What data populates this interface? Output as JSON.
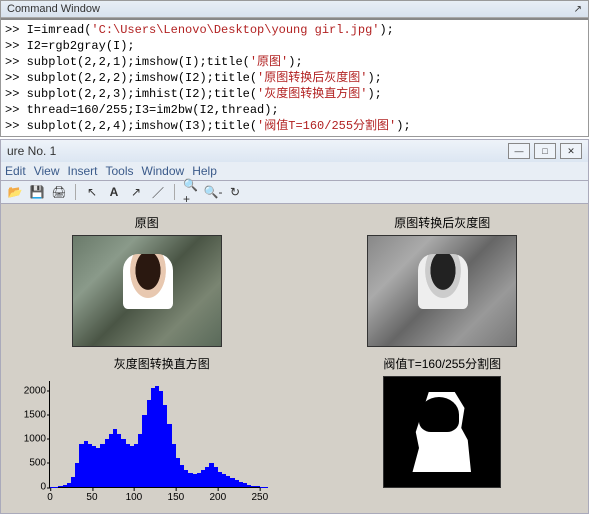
{
  "command_window": {
    "title": "Command Window",
    "lines": [
      {
        "prompt": ">> ",
        "code": "I=imread(",
        "str": "'C:\\Users\\Lenovo\\Desktop\\young girl.jpg'",
        "code2": ");"
      },
      {
        "prompt": ">> ",
        "code": "I2=rgb2gray(I);"
      },
      {
        "prompt": ">> ",
        "code": "subplot(2,2,1);imshow(I);title(",
        "str": "'原图'",
        "code2": ");"
      },
      {
        "prompt": ">> ",
        "code": "subplot(2,2,2);imshow(I2);title(",
        "str": "'原图转换后灰度图'",
        "code2": ");"
      },
      {
        "prompt": ">> ",
        "code": "subplot(2,2,3);imhist(I2);title(",
        "str": "'灰度图转换直方图'",
        "code2": ");"
      },
      {
        "prompt": ">> ",
        "code": "thread=160/255;I3=im2bw(I2,thread);"
      },
      {
        "prompt": ">> ",
        "code": "subplot(2,2,4);imshow(I3);title(",
        "str": "'阀值T=160/255分割图'",
        "code2": ");"
      }
    ]
  },
  "figure_window": {
    "title": "ure No. 1",
    "menu": [
      "Edit",
      "View",
      "Insert",
      "Tools",
      "Window",
      "Help"
    ]
  },
  "subplots": {
    "t1": "原图",
    "t2": "原图转换后灰度图",
    "t3": "灰度图转换直方图",
    "t4": "阀值T=160/255分割图"
  },
  "chart_data": {
    "type": "bar",
    "title": "灰度图转换直方图",
    "xlabel": "",
    "ylabel": "",
    "xlim": [
      0,
      255
    ],
    "ylim": [
      0,
      2200
    ],
    "xticks": [
      0,
      50,
      100,
      150,
      200,
      250
    ],
    "yticks": [
      0,
      500,
      1000,
      1500,
      2000
    ],
    "x": [
      0,
      5,
      10,
      15,
      20,
      25,
      30,
      35,
      40,
      45,
      50,
      55,
      60,
      65,
      70,
      75,
      80,
      85,
      90,
      95,
      100,
      105,
      110,
      115,
      120,
      125,
      130,
      135,
      140,
      145,
      150,
      155,
      160,
      165,
      170,
      175,
      180,
      185,
      190,
      195,
      200,
      205,
      210,
      215,
      220,
      225,
      230,
      235,
      240,
      245,
      250,
      255
    ],
    "values": [
      5,
      10,
      20,
      40,
      80,
      200,
      500,
      900,
      950,
      900,
      850,
      800,
      900,
      1000,
      1100,
      1200,
      1100,
      1000,
      900,
      850,
      900,
      1100,
      1500,
      1800,
      2050,
      2100,
      2000,
      1700,
      1300,
      900,
      600,
      450,
      350,
      300,
      280,
      300,
      350,
      420,
      500,
      420,
      320,
      260,
      220,
      180,
      140,
      110,
      80,
      50,
      30,
      15,
      8,
      3
    ]
  }
}
